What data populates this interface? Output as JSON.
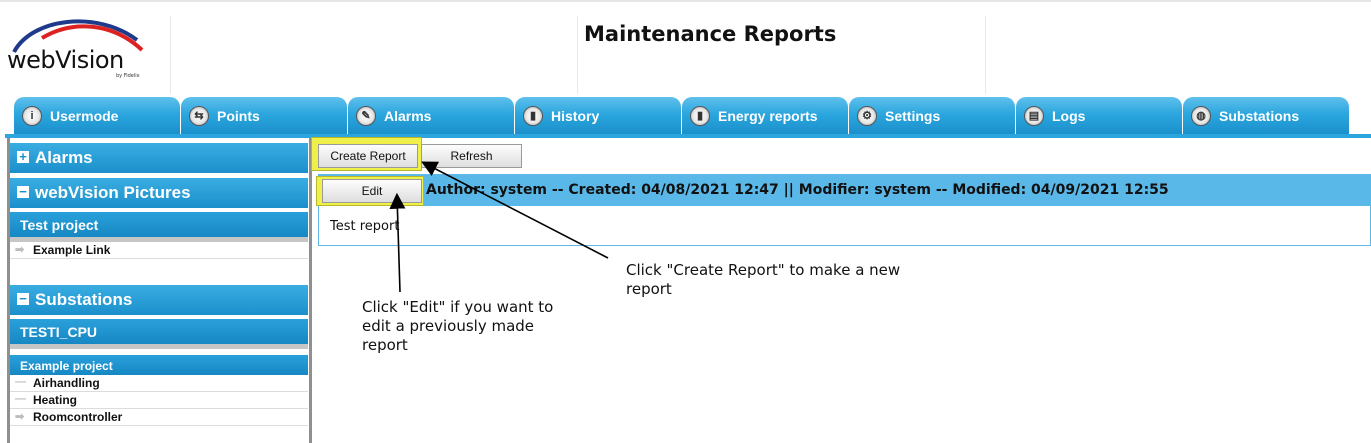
{
  "header": {
    "logo_text": "webVision",
    "logo_sub": "by Fidelix",
    "page_title": "Maintenance Reports"
  },
  "tabs": [
    {
      "label": "Usermode",
      "icon": "info-icon"
    },
    {
      "label": "Points",
      "icon": "points-icon"
    },
    {
      "label": "Alarms",
      "icon": "alarm-icon"
    },
    {
      "label": "History",
      "icon": "history-chart-icon"
    },
    {
      "label": "Energy reports",
      "icon": "energy-chart-icon"
    },
    {
      "label": "Settings",
      "icon": "settings-icon"
    },
    {
      "label": "Logs",
      "icon": "logs-icon"
    },
    {
      "label": "Substations",
      "icon": "globe-icon"
    }
  ],
  "sidebar": {
    "alarms": {
      "label": "Alarms",
      "toggle": "+"
    },
    "pictures": {
      "label": "webVision Pictures",
      "toggle": "−",
      "project": "Test project",
      "items": [
        {
          "label": "Example Link",
          "marker": "arrow"
        }
      ]
    },
    "substations": {
      "label": "Substations",
      "toggle": "−",
      "project": "TESTI_CPU",
      "subproject": "Example project",
      "items": [
        {
          "label": "Airhandling",
          "marker": "dash"
        },
        {
          "label": "Heating",
          "marker": "dash"
        },
        {
          "label": "Roomcontroller",
          "marker": "arrow"
        }
      ]
    }
  },
  "toolbar": {
    "create_label": "Create Report",
    "refresh_label": "Refresh"
  },
  "report": {
    "edit_label": "Edit",
    "meta": "Author: system -- Created: 04/08/2021 12:47 || Modifier: system -- Modified: 04/09/2021 12:55",
    "body": "Test report"
  },
  "annotations": {
    "create_note": "Click \"Create Report\" to make a new report",
    "edit_note": "Click \"Edit\" if you want to edit a previously made report"
  },
  "colors": {
    "tab_blue": "#2aa5de",
    "highlight_yellow": "#f0f04a",
    "report_header": "#5ab8e8"
  }
}
